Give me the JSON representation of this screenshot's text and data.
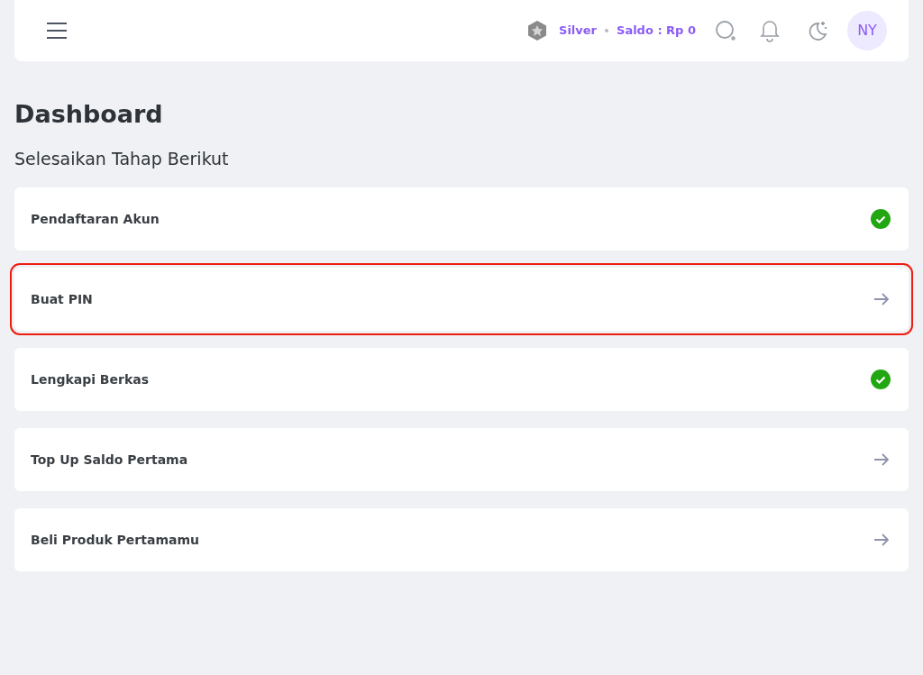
{
  "header": {
    "tier": "Silver",
    "balance": "Saldo : Rp 0",
    "avatar": "NY"
  },
  "title": "Dashboard",
  "subtitle": "Selesaikan Tahap Berikut",
  "steps": [
    {
      "label": "Pendaftaran Akun",
      "done": true,
      "highlighted": false
    },
    {
      "label": "Buat PIN",
      "done": false,
      "highlighted": true
    },
    {
      "label": "Lengkapi Berkas",
      "done": true,
      "highlighted": false
    },
    {
      "label": "Top Up Saldo Pertama",
      "done": false,
      "highlighted": false
    },
    {
      "label": "Beli Produk Pertamamu",
      "done": false,
      "highlighted": false
    }
  ]
}
